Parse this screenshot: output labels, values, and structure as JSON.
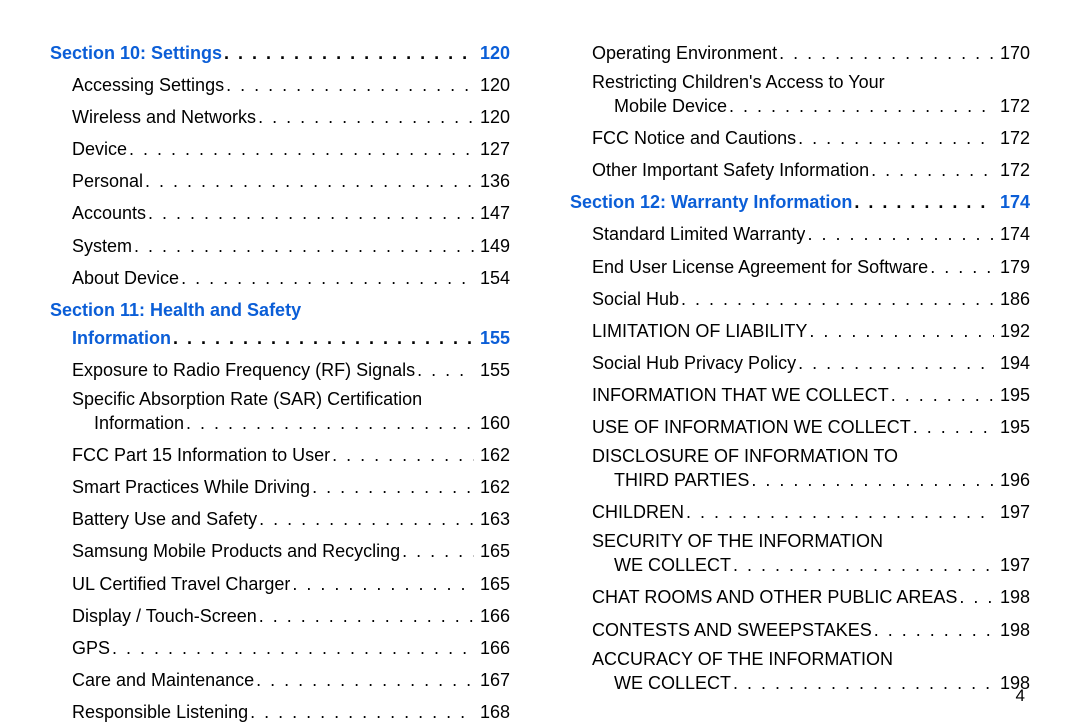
{
  "pageNumber": "4",
  "leftColumn": [
    {
      "type": "section",
      "label": "Section 10:  Settings",
      "page": "120"
    },
    {
      "type": "entry",
      "indent": 1,
      "label": "Accessing Settings",
      "page": "120"
    },
    {
      "type": "entry",
      "indent": 1,
      "label": "Wireless and Networks",
      "page": "120"
    },
    {
      "type": "entry",
      "indent": 1,
      "label": "Device",
      "page": "127"
    },
    {
      "type": "entry",
      "indent": 1,
      "label": "Personal",
      "page": "136"
    },
    {
      "type": "entry",
      "indent": 1,
      "label": "Accounts",
      "page": "147"
    },
    {
      "type": "entry",
      "indent": 1,
      "label": "System",
      "page": "149"
    },
    {
      "type": "entry",
      "indent": 1,
      "label": "About Device",
      "page": "154"
    },
    {
      "type": "section-wrap",
      "line1": "Section 11:  Health and Safety",
      "line2": "Information",
      "page": "155"
    },
    {
      "type": "entry",
      "indent": 1,
      "label": "Exposure to Radio Frequency (RF) Signals",
      "page": "155"
    },
    {
      "type": "wrap",
      "indent": 1,
      "line1": "Specific Absorption Rate (SAR) Certification",
      "line2": "Information",
      "page": "160"
    },
    {
      "type": "entry",
      "indent": 1,
      "label": "FCC Part 15 Information to User",
      "page": "162"
    },
    {
      "type": "entry",
      "indent": 1,
      "label": "Smart Practices While Driving",
      "page": "162"
    },
    {
      "type": "entry",
      "indent": 1,
      "label": "Battery Use and Safety",
      "page": "163"
    },
    {
      "type": "entry",
      "indent": 1,
      "label": "Samsung Mobile Products and Recycling",
      "page": "165"
    },
    {
      "type": "entry",
      "indent": 1,
      "label": "UL Certified Travel Charger",
      "page": "165"
    },
    {
      "type": "entry",
      "indent": 1,
      "label": "Display / Touch-Screen",
      "page": "166"
    },
    {
      "type": "entry",
      "indent": 1,
      "label": "GPS",
      "page": "166"
    },
    {
      "type": "entry",
      "indent": 1,
      "label": "Care and Maintenance",
      "page": "167"
    },
    {
      "type": "entry",
      "indent": 1,
      "label": "Responsible Listening",
      "page": "168"
    }
  ],
  "rightColumn": [
    {
      "type": "entry",
      "indent": 1,
      "label": "Operating Environment",
      "page": "170"
    },
    {
      "type": "wrap",
      "indent": 1,
      "line1": "Restricting Children's Access to Your",
      "line2": "Mobile Device",
      "page": "172"
    },
    {
      "type": "entry",
      "indent": 1,
      "label": "FCC Notice and Cautions",
      "page": "172"
    },
    {
      "type": "entry",
      "indent": 1,
      "label": "Other Important Safety Information",
      "page": "172"
    },
    {
      "type": "section",
      "label": "Section 12:  Warranty Information",
      "page": "174"
    },
    {
      "type": "entry",
      "indent": 1,
      "label": "Standard Limited Warranty",
      "page": "174"
    },
    {
      "type": "entry",
      "indent": 1,
      "label": "End User License Agreement for Software",
      "page": "179"
    },
    {
      "type": "entry",
      "indent": 1,
      "label": "Social Hub",
      "page": "186"
    },
    {
      "type": "entry",
      "indent": 1,
      "label": "LIMITATION OF LIABILITY",
      "page": "192"
    },
    {
      "type": "entry",
      "indent": 1,
      "label": "Social Hub Privacy Policy",
      "page": "194"
    },
    {
      "type": "entry",
      "indent": 1,
      "label": "INFORMATION THAT WE COLLECT",
      "page": "195"
    },
    {
      "type": "entry",
      "indent": 1,
      "label": "USE OF INFORMATION WE COLLECT",
      "page": "195"
    },
    {
      "type": "wrap",
      "indent": 1,
      "line1": "DISCLOSURE OF INFORMATION TO",
      "line2": "THIRD PARTIES",
      "page": "196"
    },
    {
      "type": "entry",
      "indent": 1,
      "label": "CHILDREN",
      "page": "197"
    },
    {
      "type": "wrap",
      "indent": 1,
      "line1": "SECURITY OF THE INFORMATION",
      "line2": "WE COLLECT",
      "page": "197"
    },
    {
      "type": "entry",
      "indent": 1,
      "label": "CHAT ROOMS AND OTHER PUBLIC AREAS",
      "page": "198"
    },
    {
      "type": "entry",
      "indent": 1,
      "label": "CONTESTS AND SWEEPSTAKES",
      "page": "198"
    },
    {
      "type": "wrap",
      "indent": 1,
      "line1": "ACCURACY OF THE INFORMATION",
      "line2": "WE COLLECT",
      "page": "198"
    }
  ]
}
